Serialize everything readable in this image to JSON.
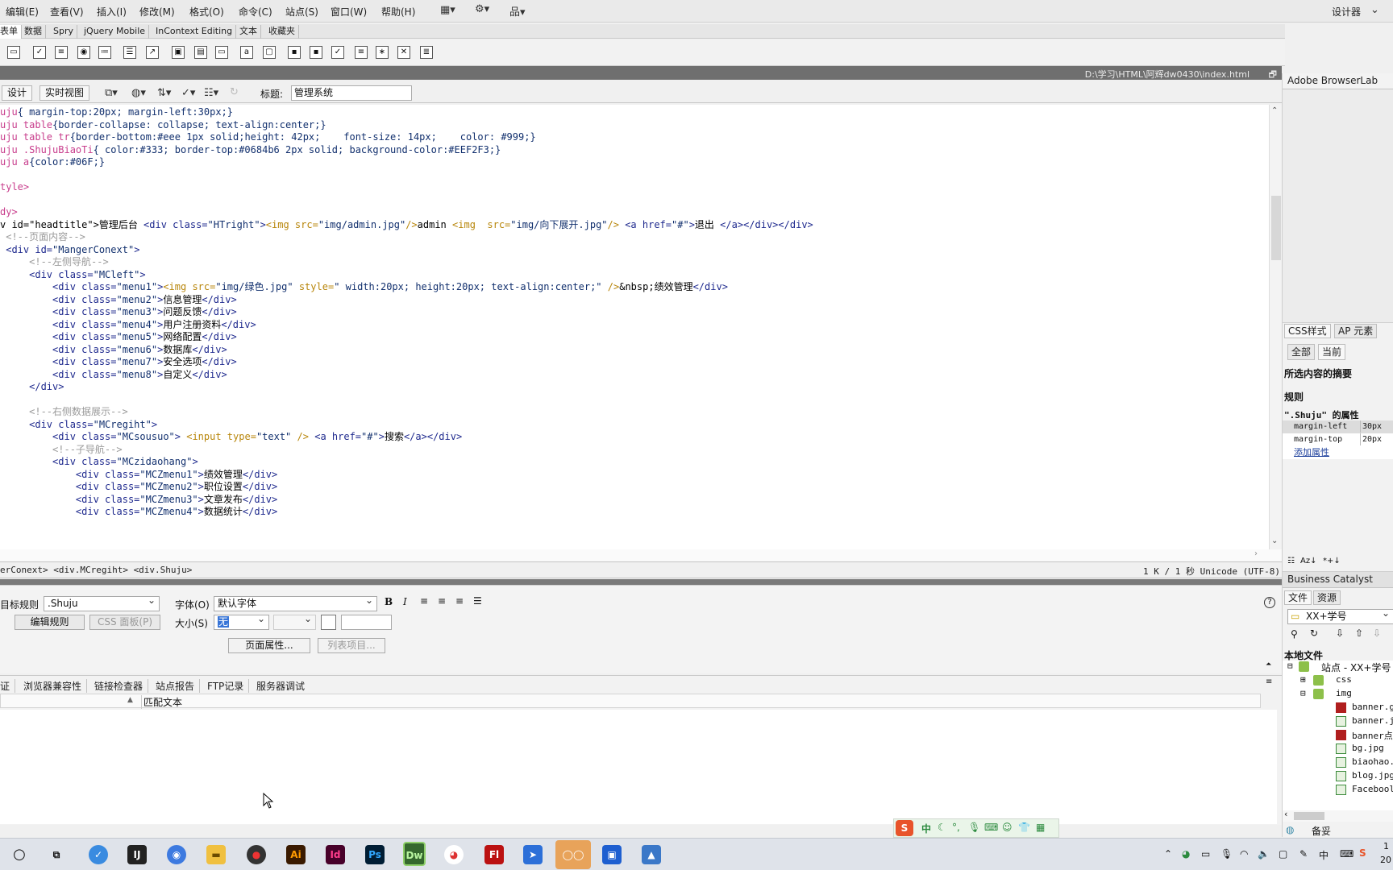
{
  "menubar": {
    "items": [
      "编辑(E)",
      "查看(V)",
      "插入(I)",
      "修改(M)",
      "格式(O)",
      "命令(C)",
      "站点(S)",
      "窗口(W)",
      "帮助(H)"
    ],
    "workspace": "设计器"
  },
  "insert_tabs": [
    "表单",
    "数据",
    "Spry",
    "jQuery Mobile",
    "InContext Editing",
    "文本",
    "收藏夹"
  ],
  "file_path": "D:\\学习\\HTML\\阿辉dw0430\\index.html",
  "doc_toolbar": {
    "design_label": "设计",
    "live_view_label": "实时视图",
    "title_label": "标题:",
    "title_value": "管理系统"
  },
  "code_lines": [
    "uju{ margin-top:20px; margin-left:30px;}",
    "uju table{border-collapse: collapse; text-align:center;}",
    "uju table tr{border-bottom:#eee 1px solid;height: 42px;    font-size: 14px;    color: #999;}",
    "uju .ShujuBiaoTi{ color:#333; border-top:#0684b6 2px solid; background-color:#EEF2F3;}",
    "uju a{color:#06F;}",
    "",
    "tyle>",
    "",
    "dy>",
    "v id=\"headtitle\">管理后台 <div class=\"HTright\"><img src=\"img/admin.jpg\"/>admin <img  src=\"img/向下展开.jpg\"/> <a href=\"#\">退出 </a></div></div>",
    " <!--页面内容-->",
    " <div id=\"MangerConext\">",
    "     <!--左侧导航-->",
    "     <div class=\"MCleft\">",
    "         <div class=\"menu1\"><img src=\"img/绿色.jpg\" style=\" width:20px; height:20px; text-align:center;\" />&nbsp;绩效管理</div>",
    "         <div class=\"menu2\">信息管理</div>",
    "         <div class=\"menu3\">问题反馈</div>",
    "         <div class=\"menu4\">用户注册资料</div>",
    "         <div class=\"menu5\">网络配置</div>",
    "         <div class=\"menu6\">数据库</div>",
    "         <div class=\"menu7\">安全选项</div>",
    "         <div class=\"menu8\">自定义</div>",
    "     </div>",
    "",
    "     <!--右侧数据展示-->",
    "     <div class=\"MCregiht\">",
    "         <div class=\"MCsousuo\"> <input type=\"text\" /> <a href=\"#\">搜索</a></div>",
    "         <!--子导航-->",
    "         <div class=\"MCzidaohang\">",
    "             <div class=\"MCZmenu1\">绩效管理</div>",
    "             <div class=\"MCZmenu2\">职位设置</div>",
    "             <div class=\"MCZmenu3\">文章发布</div>",
    "             <div class=\"MCZmenu4\">数据统计</div>"
  ],
  "tag_selector": "erConext> <div.MCregiht> <div.Shuju>",
  "status_right": "1 K / 1 秒  Unicode (UTF-8)",
  "properties": {
    "target_rule_label": "目标规则",
    "target_rule_value": ".Shuju",
    "edit_rule": "编辑规则",
    "css_panel": "CSS 面板(P)",
    "font_label": "字体(O)",
    "font_value": "默认字体",
    "size_label": "大小(S)",
    "size_value": "无",
    "page_props": "页面属性...",
    "list_items": "列表项目..."
  },
  "results_tabs": [
    "证",
    "浏览器兼容性",
    "链接检查器",
    "站点报告",
    "FTP记录",
    "服务器调试"
  ],
  "results_header": "匹配文本",
  "panel_browserlab": "Adobe BrowserLab",
  "css_panel": {
    "tabs": [
      "CSS样式",
      "AP 元素"
    ],
    "mode_all": "全部",
    "mode_current": "当前",
    "summary": "所选内容的摘要",
    "rules": "规则",
    "props_title": "\".Shuju\" 的属性",
    "props": [
      {
        "name": "margin-left",
        "value": "30px"
      },
      {
        "name": "margin-top",
        "value": "20px"
      }
    ],
    "add_prop": "添加属性"
  },
  "files_panel": {
    "header": "Business Catalyst",
    "tabs": [
      "文件",
      "资源"
    ],
    "site_select": "XX+学号",
    "local_files": "本地文件",
    "tree": [
      {
        "label": "站点 - XX+学号",
        "type": "site"
      },
      {
        "label": "css",
        "type": "folder"
      },
      {
        "label": "img",
        "type": "folder"
      },
      {
        "label": "banner.g",
        "type": "file-red"
      },
      {
        "label": "banner.j",
        "type": "file"
      },
      {
        "label": "banner点",
        "type": "file-red"
      },
      {
        "label": "bg.jpg",
        "type": "file"
      },
      {
        "label": "biaohao.",
        "type": "file"
      },
      {
        "label": "blog.jpg",
        "type": "file"
      },
      {
        "label": "Facebool",
        "type": "file"
      }
    ],
    "bottom_label": "备妥"
  },
  "ime": {
    "mode": "中"
  },
  "taskbar": {
    "apps": [
      "Ai",
      "Id",
      "Ps",
      "Dw",
      "Fl"
    ],
    "clock_partial": "1",
    "date_partial": "20"
  }
}
